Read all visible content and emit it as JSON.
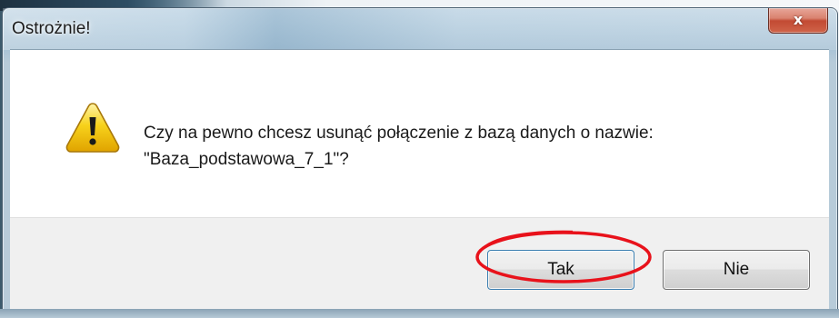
{
  "window": {
    "title": "Ostrożnie!",
    "close_glyph": "x"
  },
  "dialog": {
    "icon": "warning-icon",
    "message_line1": "Czy na pewno chcesz usunąć połączenie z bazą danych o nazwie:",
    "message_line2": "\"Baza_podstawowa_7_1\"?"
  },
  "buttons": {
    "yes_label": "Tak",
    "no_label": "Nie"
  },
  "annotation": {
    "type": "red-ellipse",
    "target": "yes-button",
    "color": "#e8121b"
  },
  "colors": {
    "content_bg": "#ffffff",
    "footer_bg": "#f0f0f0",
    "close_button": "#c24a33",
    "warning_yellow": "#f5c400"
  }
}
